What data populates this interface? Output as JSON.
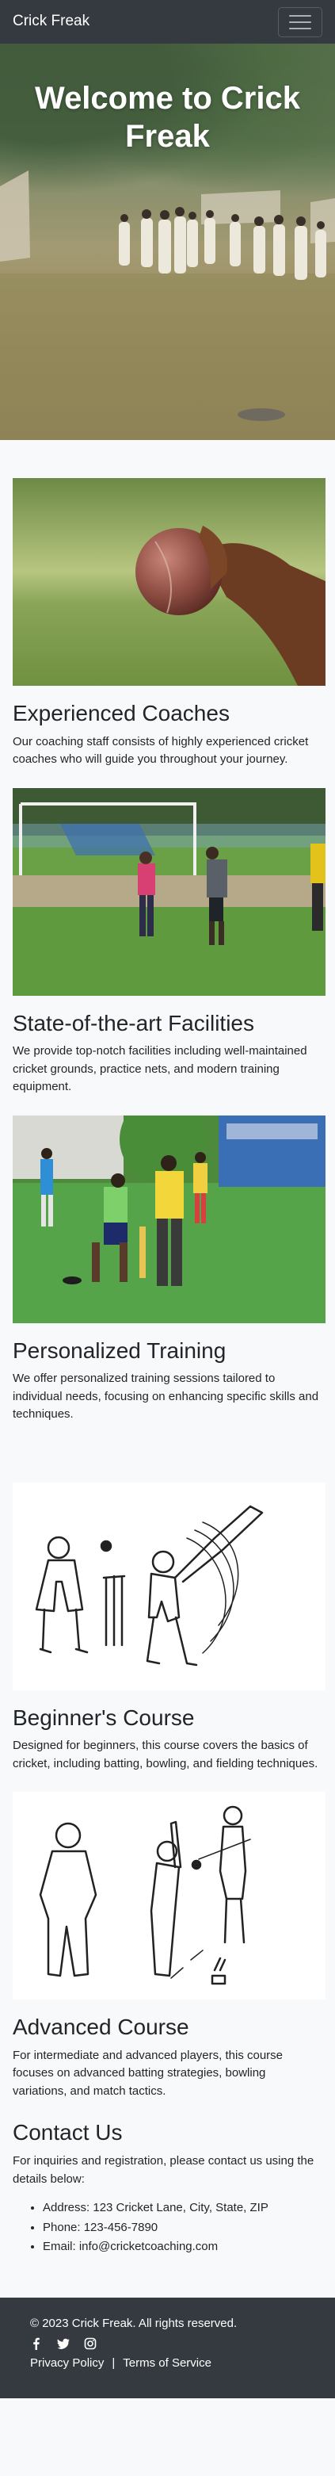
{
  "navbar": {
    "brand": "Crick Freak",
    "toggle_icon": "hamburger-menu-icon"
  },
  "hero": {
    "title": "Welcome to Crick Freak"
  },
  "features": [
    {
      "image_icon": "cricket-ball-in-hand-photo",
      "title": "Experienced Coaches",
      "text": "Our coaching staff consists of highly experienced cricket coaches who will guide you throughout your journey."
    },
    {
      "image_icon": "practice-ground-photo",
      "title": "State-of-the-art Facilities",
      "text": "We provide top-notch facilities including well-maintained cricket grounds, practice nets, and modern training equipment."
    },
    {
      "image_icon": "coach-training-batsman-photo",
      "title": "Personalized Training",
      "text": "We offer personalized training sessions tailored to individual needs, focusing on enhancing specific skills and techniques."
    },
    {
      "image_icon": "batsman-sketch-illustration",
      "title": "Beginner's Course",
      "text": "Designed for beginners, this course covers the basics of cricket, including batting, bowling, and fielding techniques."
    },
    {
      "image_icon": "match-sketch-illustration",
      "title": "Advanced Course",
      "text": "For intermediate and advanced players, this course focuses on advanced batting strategies, bowling variations, and match tactics."
    }
  ],
  "contact": {
    "title": "Contact Us",
    "intro": "For inquiries and registration, please contact us using the details below:",
    "items": [
      "Address: 123 Cricket Lane, City, State, ZIP",
      "Phone: 123-456-7890",
      "Email: info@cricketcoaching.com"
    ]
  },
  "footer": {
    "copyright": "© 2023 Crick Freak. All rights reserved.",
    "social_icons": [
      "facebook-icon",
      "twitter-icon",
      "instagram-icon"
    ],
    "privacy": "Privacy Policy",
    "separator": "|",
    "terms": "Terms of Service"
  },
  "colors": {
    "navbar_bg": "#343a40",
    "page_bg": "#f8f9fa",
    "text": "#212529"
  }
}
